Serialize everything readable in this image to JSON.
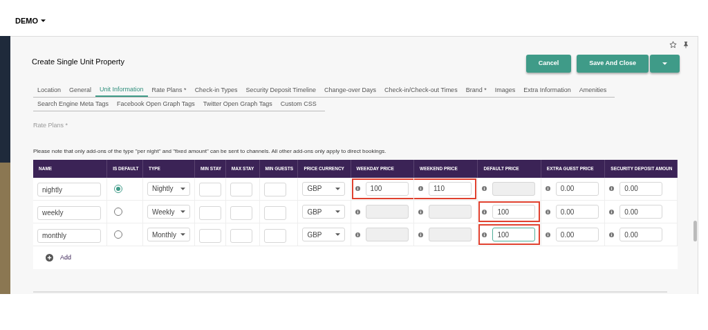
{
  "header": {
    "title": "DEMO"
  },
  "page_title": "Create Single Unit Property",
  "actions": [
    {
      "kind": "button",
      "label": "Cancel"
    },
    {
      "kind": "button",
      "label": "Save And Close"
    },
    {
      "kind": "caret"
    }
  ],
  "tab_rows": [
    [
      {
        "label": "Location",
        "selected": false
      },
      {
        "label": "General",
        "selected": false
      },
      {
        "label": "Unit Information",
        "selected": true
      },
      {
        "label": "Rate Plans *",
        "selected": false
      },
      {
        "label": "Check-in Types",
        "selected": false
      },
      {
        "label": "Security Deposit Timeline",
        "selected": false
      },
      {
        "label": "Change-over Days",
        "selected": false
      },
      {
        "label": "Check-in/Check-out Times",
        "selected": false
      },
      {
        "label": "Brand *",
        "selected": false
      },
      {
        "label": "Images",
        "selected": false
      },
      {
        "label": "Extra Information",
        "selected": false
      },
      {
        "label": "Amenities",
        "selected": false
      }
    ],
    [
      {
        "label": "Search Engine Meta Tags",
        "selected": false
      },
      {
        "label": "Facebook Open Graph Tags",
        "selected": false
      },
      {
        "label": "Twitter Open Graph Tags",
        "selected": false
      },
      {
        "label": "Custom CSS",
        "selected": false
      }
    ]
  ],
  "section_label": "Rate Plans *",
  "note": "Please note that only add-ons of the type \"per night\" and \"fixed amount\" can be sent to channels. All other add-ons only apply to direct bookings.",
  "table": {
    "columns": [
      "NAME",
      "IS DEFAULT",
      "TYPE",
      "MIN STAY",
      "MAX STAY",
      "MIN GUESTS",
      "PRICE CURRENCY",
      "WEEKDAY PRICE",
      "WEEKEND PRICE",
      "DEFAULT PRICE",
      "EXTRA GUEST PRICE",
      "SECURITY DEPOSIT AMOUN"
    ],
    "rows": [
      {
        "name": "nightly",
        "selected": true,
        "type": "Nightly",
        "currency": "GBP",
        "prices": [
          {
            "value": "100",
            "disabled": false,
            "highlighted": true,
            "focused": false
          },
          {
            "value": "110",
            "disabled": false,
            "highlighted": true,
            "focused": false
          },
          {
            "disabled": true,
            "highlighted": false,
            "focused": false
          },
          {
            "value": "0.00",
            "disabled": false,
            "highlighted": false,
            "focused": false
          },
          {
            "value": "0.00",
            "disabled": false,
            "highlighted": false,
            "focused": false
          }
        ]
      },
      {
        "name": "weekly",
        "selected": false,
        "type": "Weekly",
        "currency": "GBP",
        "prices": [
          {
            "disabled": true,
            "highlighted": false,
            "focused": false
          },
          {
            "disabled": true,
            "highlighted": false,
            "focused": false
          },
          {
            "value": "100",
            "disabled": false,
            "highlighted": true,
            "focused": false
          },
          {
            "value": "0.00",
            "disabled": false,
            "highlighted": false,
            "focused": false
          },
          {
            "value": "0.00",
            "disabled": false,
            "highlighted": false,
            "focused": false
          }
        ]
      },
      {
        "name": "monthly",
        "selected": false,
        "type": "Monthly",
        "currency": "GBP",
        "prices": [
          {
            "disabled": true,
            "highlighted": false,
            "focused": false
          },
          {
            "disabled": true,
            "highlighted": false,
            "focused": false
          },
          {
            "value": "100",
            "disabled": false,
            "highlighted": true,
            "focused": true
          },
          {
            "value": "0.00",
            "disabled": false,
            "highlighted": false,
            "focused": false
          },
          {
            "value": "0.00",
            "disabled": false,
            "highlighted": false,
            "focused": false
          }
        ]
      }
    ],
    "add_label": "Add"
  }
}
